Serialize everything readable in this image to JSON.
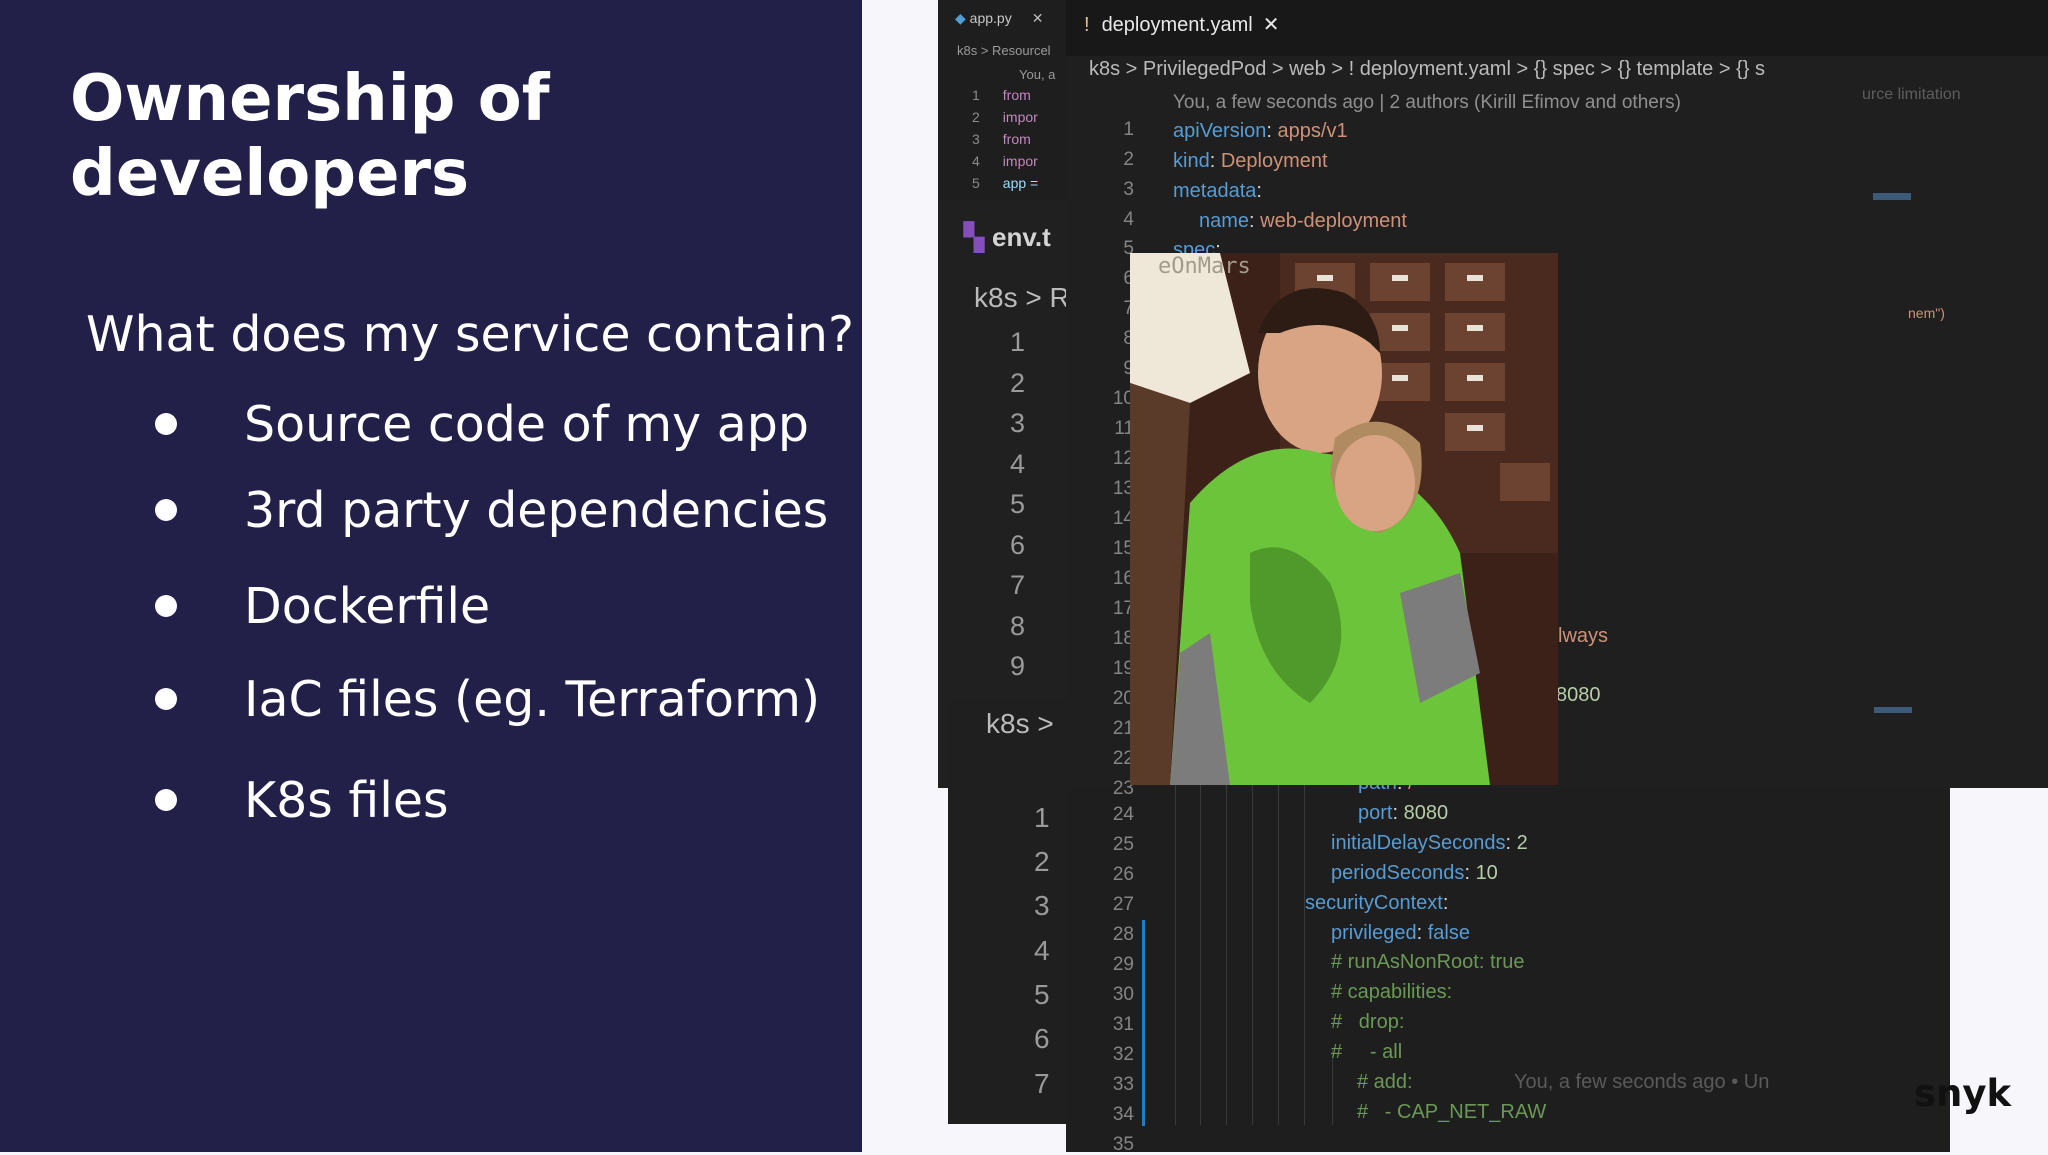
{
  "slide": {
    "title": "Ownership of developers",
    "question": "What does my service contain?",
    "bullets": [
      "Source code of my app",
      "3rd party dependencies",
      "Dockerfile",
      "IaC files (eg. Terraform)",
      "K8s files"
    ]
  },
  "back_editor": {
    "tab": "app.py",
    "breadcrumb": "k8s > Resourcel",
    "blame": "You, a",
    "lines": [
      {
        "num": "1",
        "kw": "from"
      },
      {
        "num": "2",
        "kw": "impor"
      },
      {
        "num": "3",
        "kw": "from"
      },
      {
        "num": "4",
        "kw": "impor"
      },
      {
        "num": "5",
        "kw": "app ="
      }
    ]
  },
  "env_editor": {
    "tab": "env.t",
    "breadcrumb": "k8s > R",
    "line_numbers": [
      "1",
      "2",
      "3",
      "4",
      "5",
      "6",
      "7",
      "8",
      "9"
    ]
  },
  "k8s_editor": {
    "breadcrumb": "k8s >",
    "line_numbers": [
      "1",
      "2",
      "3",
      "4",
      "5",
      "6",
      "7"
    ]
  },
  "main_editor": {
    "tab": "deployment.yaml",
    "breadcrumbs": "k8s > PrivilegedPod > web > ! deployment.yaml > {} spec > {} template > {} s",
    "blame": "You, a few seconds ago | 2 authors (Kirill Efimov and others)",
    "blame_right": "urce limitation",
    "line_numbers": [
      "1",
      "2",
      "3",
      "4",
      "5",
      "6",
      "7",
      "8",
      "9",
      "10",
      "11",
      "12",
      "13",
      "14",
      "15",
      "16",
      "17",
      "18",
      "19",
      "20",
      "21",
      "22",
      "23",
      "24",
      "25",
      "26",
      "27",
      "28",
      "29",
      "30",
      "31",
      "32",
      "33",
      "34",
      "35"
    ],
    "partial_right": {
      "line18": "lways",
      "line20": "8080",
      "nem": "nem\")"
    },
    "inline_blame": "You, a few seconds ago • Un",
    "code": {
      "l1_key": "apiVersion",
      "l1_val": "apps/v1",
      "l2_key": "kind",
      "l2_val": "Deployment",
      "l3_key": "metadata",
      "l4_key": "name",
      "l4_val": "web-deployment",
      "l5_key": "spec",
      "l23_key": "path",
      "l23_val": "/",
      "l24_key": "port",
      "l24_val": "8080",
      "l25_key": "initialDelaySeconds",
      "l25_val": "2",
      "l26_key": "periodSeconds",
      "l26_val": "10",
      "l27_key": "securityContext",
      "l28_key": "privileged",
      "l28_val": "false",
      "l29": "# runAsNonRoot: true",
      "l30": "# capabilities:",
      "l31": "#   drop:",
      "l32": "#     - all",
      "l33": "# add:",
      "l34": "#   - CAP_NET_RAW"
    }
  },
  "gif": {
    "watermark": "eOnMars"
  },
  "brand": {
    "logo": "snyk"
  },
  "colors": {
    "slide_bg": "#222049",
    "editor_bg": "#1e1e1e",
    "yaml_key": "#569cd6",
    "yaml_string": "#ce9178",
    "yaml_number": "#b5cea8",
    "comment": "#6a9955"
  }
}
